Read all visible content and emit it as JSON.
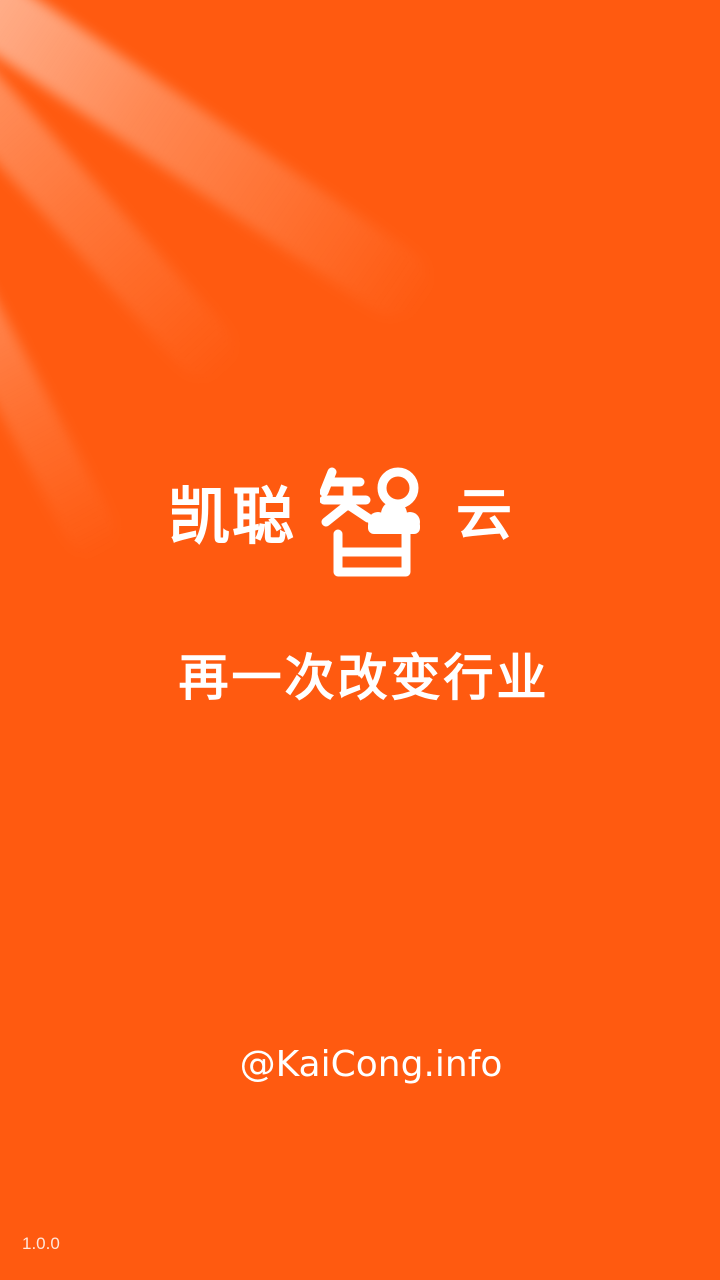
{
  "splash": {
    "brand_prefix": "凯聪",
    "brand_mark_text": "智",
    "brand_suffix": "云",
    "slogan": "再一次改变行业",
    "website": "@KaiCong.info",
    "version": "1.0.0"
  },
  "colors": {
    "background": "#ff5a10",
    "text": "#ffffff"
  },
  "icons": {
    "brand_mark": "cloud-wisdom-logo-icon"
  }
}
